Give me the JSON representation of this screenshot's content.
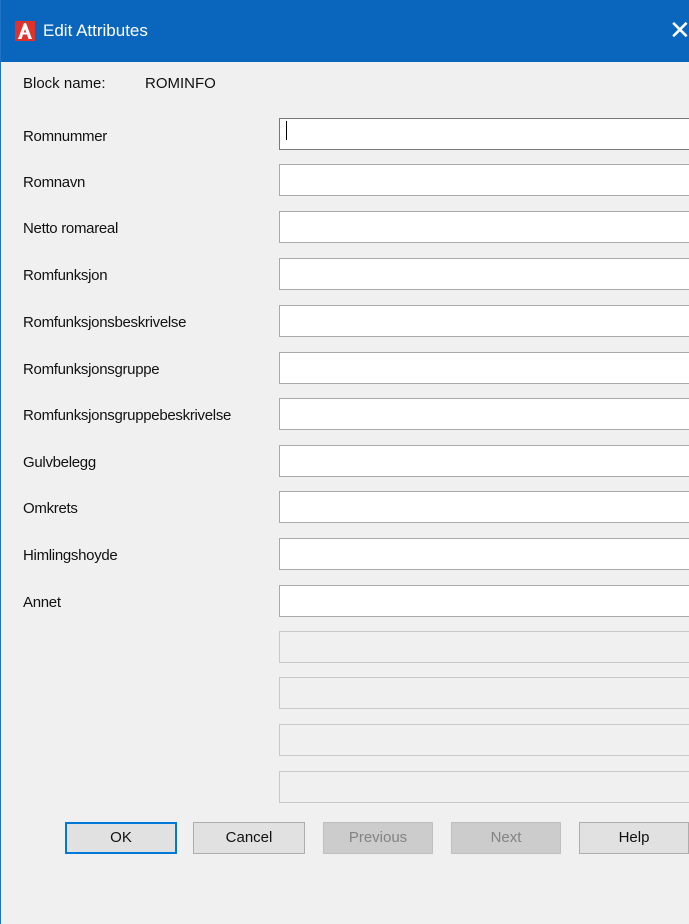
{
  "window": {
    "title": "Edit Attributes",
    "icon": "autocad-icon",
    "close_glyph": "✕"
  },
  "block": {
    "label": "Block name:",
    "value": "ROMINFO"
  },
  "attributes": [
    {
      "label": "Romnummer",
      "value": ""
    },
    {
      "label": "Romnavn",
      "value": ""
    },
    {
      "label": "Netto romareal",
      "value": ""
    },
    {
      "label": "Romfunksjon",
      "value": ""
    },
    {
      "label": "Romfunksjonsbeskrivelse",
      "value": ""
    },
    {
      "label": "Romfunksjonsgruppe",
      "value": ""
    },
    {
      "label": "Romfunksjonsgruppebeskrivelse",
      "value": ""
    },
    {
      "label": "Gulvbelegg",
      "value": ""
    },
    {
      "label": "Omkrets",
      "value": ""
    },
    {
      "label": "Himlingshoyde",
      "value": ""
    },
    {
      "label": "Annet",
      "value": ""
    }
  ],
  "buttons": {
    "ok": "OK",
    "cancel": "Cancel",
    "previous": "Previous",
    "next": "Next",
    "help": "Help"
  },
  "colors": {
    "titlebar": "#0a66bd",
    "accent": "#0078d7",
    "app_icon_red": "#e0312b"
  }
}
